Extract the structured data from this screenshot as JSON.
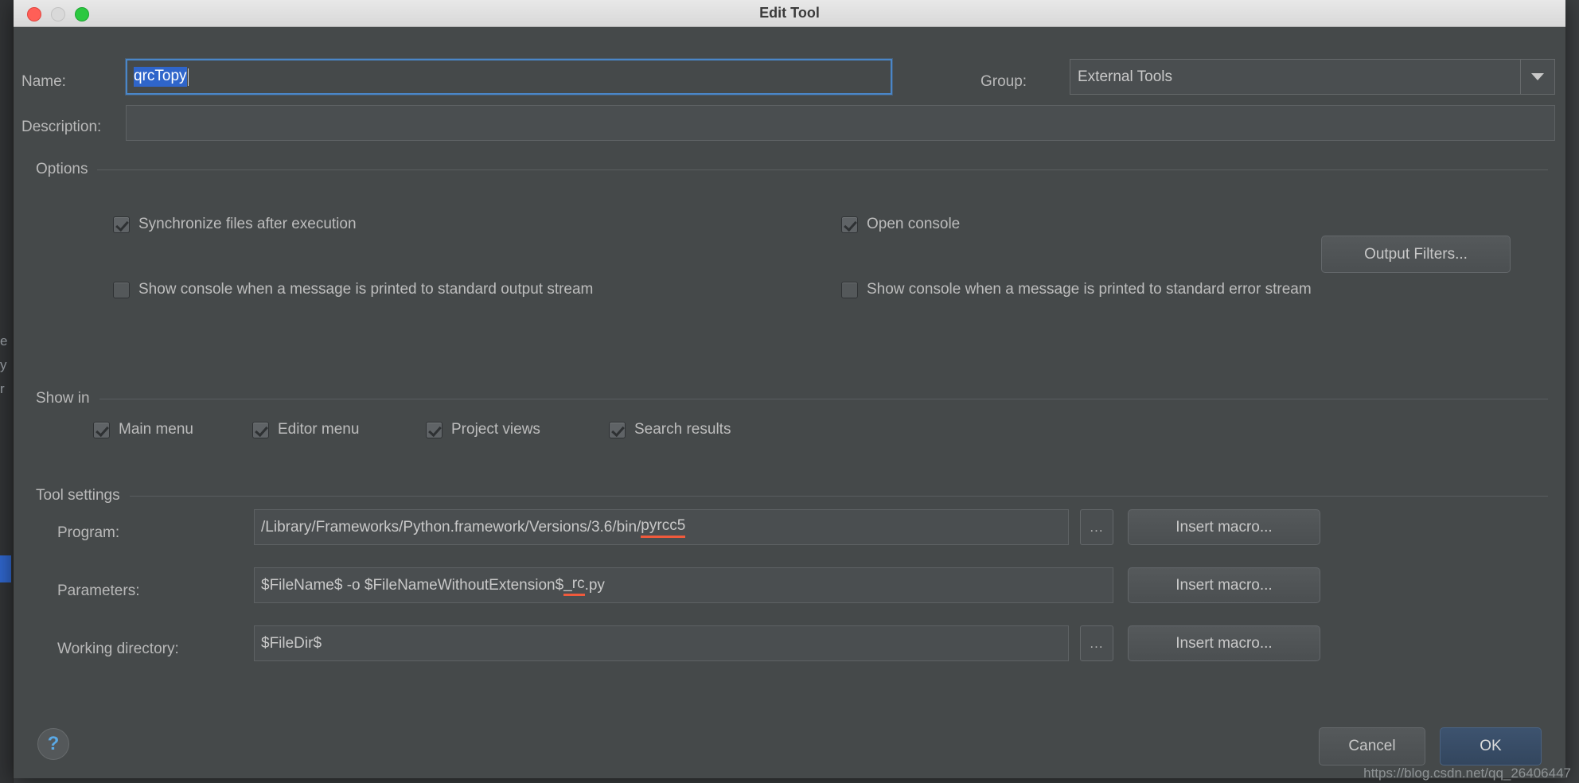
{
  "window": {
    "title": "Edit Tool",
    "traffic_lights": [
      "close-button",
      "minimize-button",
      "zoom-button"
    ]
  },
  "form": {
    "name_label": "Name:",
    "name_value": "qrcTopy",
    "description_label": "Description:",
    "description_value": "",
    "group_label": "Group:",
    "group_value": "External Tools"
  },
  "options": {
    "section_label": "Options",
    "checkboxes": [
      {
        "label": "Synchronize files after execution",
        "checked": true
      },
      {
        "label": "Open console",
        "checked": true
      },
      {
        "label": "Show console when a message is printed to standard output stream",
        "checked": false
      },
      {
        "label": "Show console when a message is printed to standard error stream",
        "checked": false
      }
    ],
    "output_filters_button": "Output Filters..."
  },
  "show_in": {
    "section_label": "Show in",
    "checkboxes": [
      {
        "label": "Main menu",
        "checked": true
      },
      {
        "label": "Editor menu",
        "checked": true
      },
      {
        "label": "Project views",
        "checked": true
      },
      {
        "label": "Search results",
        "checked": true
      }
    ]
  },
  "tool_settings": {
    "section_label": "Tool settings",
    "program_label": "Program:",
    "program_value": "/Library/Frameworks/Python.framework/Versions/3.6/bin/",
    "program_value_error": "pyrcc5",
    "parameters_label": "Parameters:",
    "parameters_value": "$FileName$ -o $FileNameWithoutExtension$",
    "parameters_value_error": "_rc",
    "parameters_value_tail": ".py",
    "working_directory_label": "Working directory:",
    "working_directory_value": "$FileDir$",
    "browse_button": "...",
    "insert_macro_button": "Insert macro..."
  },
  "footer": {
    "help_button": "?",
    "cancel_button": "Cancel",
    "ok_button": "OK"
  },
  "watermark": "https://blog.csdn.net/qq_26406447",
  "background": {
    "ghost_lines": [
      "e",
      "y",
      "r"
    ]
  },
  "colors": {
    "dialog_bg": "#45494a",
    "titlebar": "#e0e0e0",
    "accent_selection": "#2f65ca",
    "focus_border": "#4a86c8",
    "error_underline": "#f05a3c",
    "primary_button": "#33465e"
  }
}
